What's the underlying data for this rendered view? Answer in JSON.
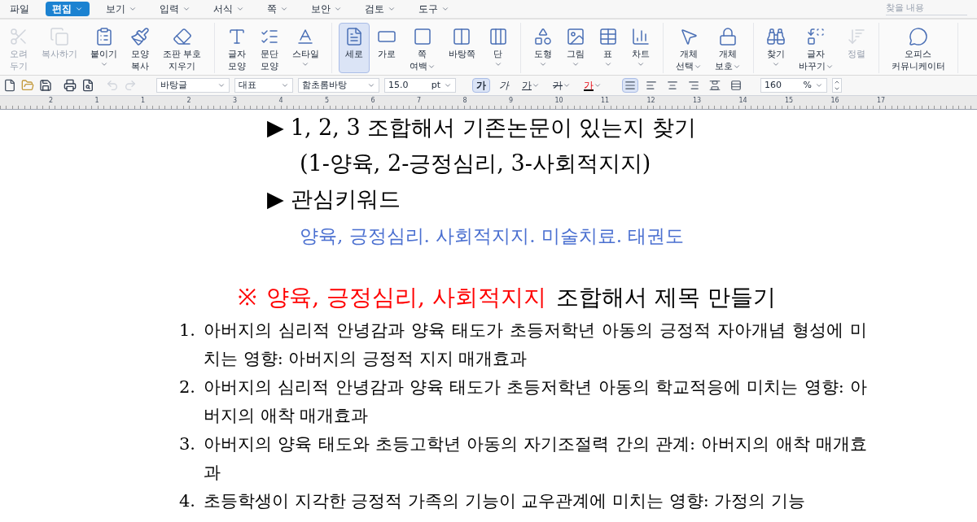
{
  "menu": [
    {
      "label": "파일",
      "selected": false,
      "dropdown": false
    },
    {
      "label": "편집",
      "selected": true,
      "dropdown": true
    },
    {
      "label": "보기",
      "selected": false,
      "dropdown": true
    },
    {
      "label": "입력",
      "selected": false,
      "dropdown": true
    },
    {
      "label": "서식",
      "selected": false,
      "dropdown": true
    },
    {
      "label": "쪽",
      "selected": false,
      "dropdown": true
    },
    {
      "label": "보안",
      "selected": false,
      "dropdown": true
    },
    {
      "label": "검토",
      "selected": false,
      "dropdown": true
    },
    {
      "label": "도구",
      "selected": false,
      "dropdown": true
    }
  ],
  "search": {
    "placeholder": "찾을 내용"
  },
  "ribbon": [
    [
      {
        "lines": [
          "오려",
          "두기"
        ],
        "disabled": true,
        "selected": false,
        "dropdown": false
      },
      {
        "lines": [
          "복사하기"
        ],
        "disabled": true,
        "selected": false,
        "dropdown": false
      },
      {
        "lines": [
          "붙이기"
        ],
        "disabled": false,
        "selected": false,
        "dropdown": true
      },
      {
        "lines": [
          "모양",
          "복사"
        ],
        "disabled": false,
        "selected": false,
        "dropdown": false
      },
      {
        "lines": [
          "조판 부호",
          "지우기"
        ],
        "disabled": false,
        "selected": false,
        "dropdown": false
      }
    ],
    [
      {
        "lines": [
          "글자",
          "모양"
        ],
        "disabled": false,
        "selected": false,
        "dropdown": false
      },
      {
        "lines": [
          "문단",
          "모양"
        ],
        "disabled": false,
        "selected": false,
        "dropdown": false
      },
      {
        "lines": [
          "스타일"
        ],
        "disabled": false,
        "selected": false,
        "dropdown": true
      }
    ],
    [
      {
        "lines": [
          "세로"
        ],
        "disabled": false,
        "selected": true,
        "dropdown": false
      },
      {
        "lines": [
          "가로"
        ],
        "disabled": false,
        "selected": false,
        "dropdown": false
      },
      {
        "lines": [
          "쪽",
          "여백"
        ],
        "disabled": false,
        "selected": false,
        "dropdown": true
      },
      {
        "lines": [
          "바탕쪽"
        ],
        "disabled": false,
        "selected": false,
        "dropdown": false
      },
      {
        "lines": [
          "단"
        ],
        "disabled": false,
        "selected": false,
        "dropdown": true
      }
    ],
    [
      {
        "lines": [
          "도형"
        ],
        "disabled": false,
        "selected": false,
        "dropdown": true
      },
      {
        "lines": [
          "그림"
        ],
        "disabled": false,
        "selected": false,
        "dropdown": true
      },
      {
        "lines": [
          "표"
        ],
        "disabled": false,
        "selected": false,
        "dropdown": true
      },
      {
        "lines": [
          "차트"
        ],
        "disabled": false,
        "selected": false,
        "dropdown": true
      }
    ],
    [
      {
        "lines": [
          "개체",
          "선택"
        ],
        "disabled": false,
        "selected": false,
        "dropdown": true
      },
      {
        "lines": [
          "개체",
          "보호"
        ],
        "disabled": false,
        "selected": false,
        "dropdown": true
      }
    ],
    [
      {
        "lines": [
          "찾기"
        ],
        "disabled": false,
        "selected": false,
        "dropdown": true
      },
      {
        "lines": [
          "글자",
          "바꾸기"
        ],
        "disabled": false,
        "selected": false,
        "dropdown": true
      },
      {
        "lines": [
          "정렬"
        ],
        "disabled": true,
        "selected": false,
        "dropdown": false
      }
    ],
    [
      {
        "lines": [
          "오피스",
          "커뮤니케이터"
        ],
        "disabled": false,
        "selected": false,
        "dropdown": false
      }
    ]
  ],
  "format": {
    "para_style": "바탕글",
    "lang": "대표",
    "font": "함초롬바탕",
    "size": "15.0",
    "unit": "pt",
    "chars": [
      {
        "label": "가",
        "kind": "bold",
        "selected": true,
        "dropdown": false
      },
      {
        "label": "가",
        "kind": "italic",
        "selected": false,
        "dropdown": false
      },
      {
        "label": "가",
        "kind": "underline",
        "selected": false,
        "dropdown": true
      },
      {
        "label": "가",
        "kind": "strike",
        "selected": false,
        "dropdown": true
      },
      {
        "label": "가",
        "kind": "color",
        "selected": false,
        "dropdown": true
      }
    ],
    "aligns": [
      {
        "kind": "justify",
        "selected": true
      },
      {
        "kind": "left",
        "selected": false
      },
      {
        "kind": "center",
        "selected": false
      },
      {
        "kind": "right",
        "selected": false
      },
      {
        "kind": "distribute",
        "selected": false
      },
      {
        "kind": "split",
        "selected": false
      }
    ],
    "line_spacing": "160",
    "spacing_unit": "%"
  },
  "ruler": [
    "2",
    "1",
    "1",
    "2",
    "3",
    "4",
    "5",
    "6",
    "7",
    "8",
    "9",
    "10",
    "11",
    "12",
    "13",
    "14",
    "15",
    "16",
    "17"
  ],
  "document": [
    {
      "kind": "arrow",
      "marker": "▶",
      "text": "1, 2, 3 조합해서 기존논문이 있는지 찾기"
    },
    {
      "kind": "indent",
      "text": "(1-양육, 2-긍정심리, 3-사회적지지)"
    },
    {
      "kind": "arrow",
      "marker": "▶",
      "text": "관심키워드"
    },
    {
      "kind": "keywords",
      "text": "양육, 긍정심리. 사회적지지. 미술치료. 태권도"
    },
    {
      "kind": "title",
      "marker": "※",
      "highlight": "양육, 긍정심리, 사회적지지",
      "text": "조합해서 제목 만들기"
    },
    {
      "kind": "item",
      "number": "1.",
      "text": "아버지의 심리적 안녕감과 양육 태도가 초등저학년 아동의 긍정적 자아개념 형성에 미치는 영향: 아버지의 긍정적 지지 매개효과"
    },
    {
      "kind": "item",
      "number": "2.",
      "text": "아버지의 심리적 안녕감과 양육 태도가 초등저학년 아동의 학교적응에 미치는 영향: 아버지의 애착 매개효과"
    },
    {
      "kind": "item",
      "number": "3.",
      "text": "아버지의 양육 태도와 초등고학년 아동의 자기조절력 간의 관계: 아버지의 애착 매개효과"
    },
    {
      "kind": "item",
      "number": "4.",
      "text": "초등학생이 지각한 긍정적 가족의 기능이 교우관계에 미치는 영향: 가정의 기능"
    }
  ]
}
